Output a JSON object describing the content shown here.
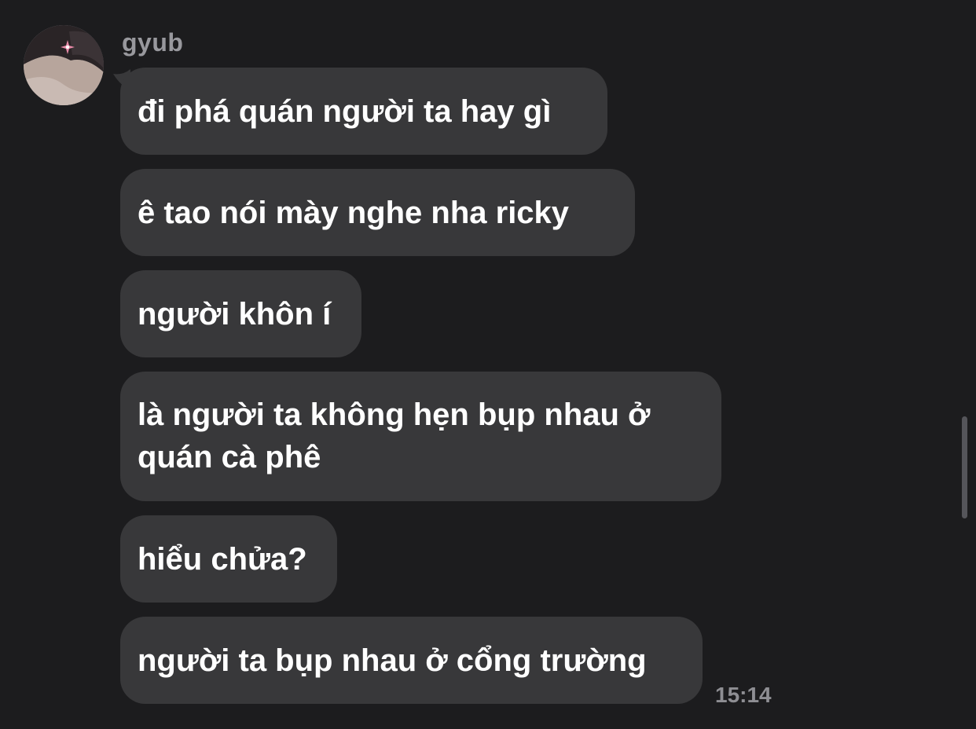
{
  "conversation": {
    "sender": "gyub",
    "messages": [
      {
        "text": "đi phá quán người ta hay gì"
      },
      {
        "text": "ê tao nói mày nghe nha ricky"
      },
      {
        "text": "người khôn í"
      },
      {
        "text": "là người ta không hẹn bụp nhau ở quán cà phê"
      },
      {
        "text": "hiểu chửa?"
      },
      {
        "text": "người ta bụp nhau ở cổng trường"
      }
    ],
    "last_timestamp": "15:14"
  },
  "colors": {
    "background": "#1c1c1e",
    "bubble": "#38383a",
    "secondary_text": "#98989d"
  },
  "icons": {
    "avatar": "avatar-photo"
  }
}
